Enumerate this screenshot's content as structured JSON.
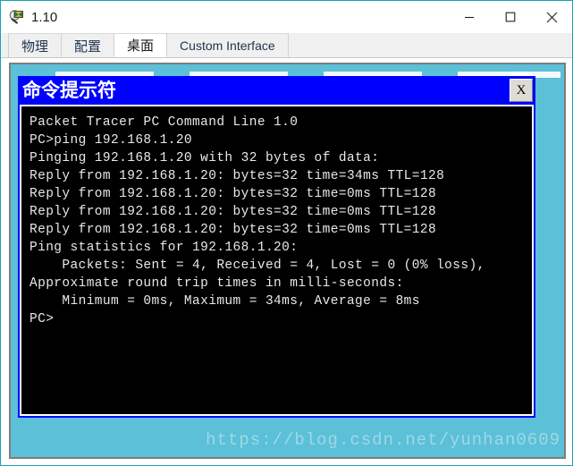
{
  "window": {
    "title": "1.10",
    "icon": "packet-tracer-magnifier-icon",
    "accent_color": "#17a2b8",
    "caption": {
      "minimize": "minimize-icon",
      "maximize": "maximize-icon",
      "close": "close-icon"
    }
  },
  "tabs": [
    {
      "label": "物理",
      "cjk": true,
      "active": false
    },
    {
      "label": "配置",
      "cjk": true,
      "active": false
    },
    {
      "label": "桌面",
      "cjk": true,
      "active": true
    },
    {
      "label": "Custom Interface",
      "cjk": false,
      "active": false
    }
  ],
  "desktop": {
    "background_color": "#5bc0d8",
    "border_color": "#7d7d7d"
  },
  "terminal_window": {
    "title": "命令提示符",
    "titlebar_color": "#0000ff",
    "close_label": "X",
    "screen_background": "#000000",
    "text_color": "#e8e8e8",
    "lines": [
      "Packet Tracer PC Command Line 1.0",
      "PC>ping 192.168.1.20",
      "",
      "Pinging 192.168.1.20 with 32 bytes of data:",
      "",
      "Reply from 192.168.1.20: bytes=32 time=34ms TTL=128",
      "Reply from 192.168.1.20: bytes=32 time=0ms TTL=128",
      "Reply from 192.168.1.20: bytes=32 time=0ms TTL=128",
      "Reply from 192.168.1.20: bytes=32 time=0ms TTL=128",
      "",
      "Ping statistics for 192.168.1.20:",
      "    Packets: Sent = 4, Received = 4, Lost = 0 (0% loss),",
      "Approximate round trip times in milli-seconds:",
      "    Minimum = 0ms, Maximum = 34ms, Average = 8ms",
      "",
      "PC>"
    ]
  },
  "watermark": {
    "text": "https://blog.csdn.net/yunhan0609"
  }
}
